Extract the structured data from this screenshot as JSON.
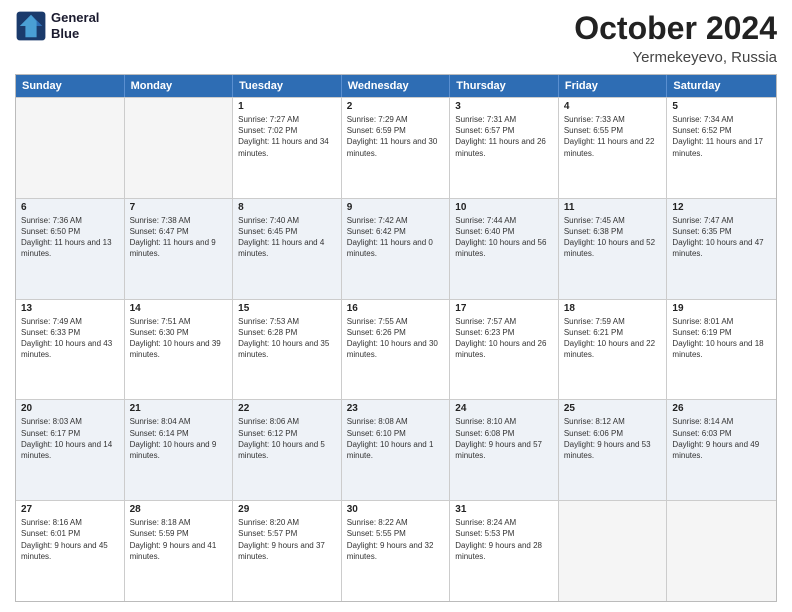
{
  "header": {
    "logo_line1": "General",
    "logo_line2": "Blue",
    "month": "October 2024",
    "location": "Yermekeyevo, Russia"
  },
  "days_of_week": [
    "Sunday",
    "Monday",
    "Tuesday",
    "Wednesday",
    "Thursday",
    "Friday",
    "Saturday"
  ],
  "weeks": [
    [
      {
        "day": "",
        "sunrise": "",
        "sunset": "",
        "daylight": "",
        "empty": true
      },
      {
        "day": "",
        "sunrise": "",
        "sunset": "",
        "daylight": "",
        "empty": true
      },
      {
        "day": "1",
        "sunrise": "Sunrise: 7:27 AM",
        "sunset": "Sunset: 7:02 PM",
        "daylight": "Daylight: 11 hours and 34 minutes."
      },
      {
        "day": "2",
        "sunrise": "Sunrise: 7:29 AM",
        "sunset": "Sunset: 6:59 PM",
        "daylight": "Daylight: 11 hours and 30 minutes."
      },
      {
        "day": "3",
        "sunrise": "Sunrise: 7:31 AM",
        "sunset": "Sunset: 6:57 PM",
        "daylight": "Daylight: 11 hours and 26 minutes."
      },
      {
        "day": "4",
        "sunrise": "Sunrise: 7:33 AM",
        "sunset": "Sunset: 6:55 PM",
        "daylight": "Daylight: 11 hours and 22 minutes."
      },
      {
        "day": "5",
        "sunrise": "Sunrise: 7:34 AM",
        "sunset": "Sunset: 6:52 PM",
        "daylight": "Daylight: 11 hours and 17 minutes."
      }
    ],
    [
      {
        "day": "6",
        "sunrise": "Sunrise: 7:36 AM",
        "sunset": "Sunset: 6:50 PM",
        "daylight": "Daylight: 11 hours and 13 minutes."
      },
      {
        "day": "7",
        "sunrise": "Sunrise: 7:38 AM",
        "sunset": "Sunset: 6:47 PM",
        "daylight": "Daylight: 11 hours and 9 minutes."
      },
      {
        "day": "8",
        "sunrise": "Sunrise: 7:40 AM",
        "sunset": "Sunset: 6:45 PM",
        "daylight": "Daylight: 11 hours and 4 minutes."
      },
      {
        "day": "9",
        "sunrise": "Sunrise: 7:42 AM",
        "sunset": "Sunset: 6:42 PM",
        "daylight": "Daylight: 11 hours and 0 minutes."
      },
      {
        "day": "10",
        "sunrise": "Sunrise: 7:44 AM",
        "sunset": "Sunset: 6:40 PM",
        "daylight": "Daylight: 10 hours and 56 minutes."
      },
      {
        "day": "11",
        "sunrise": "Sunrise: 7:45 AM",
        "sunset": "Sunset: 6:38 PM",
        "daylight": "Daylight: 10 hours and 52 minutes."
      },
      {
        "day": "12",
        "sunrise": "Sunrise: 7:47 AM",
        "sunset": "Sunset: 6:35 PM",
        "daylight": "Daylight: 10 hours and 47 minutes."
      }
    ],
    [
      {
        "day": "13",
        "sunrise": "Sunrise: 7:49 AM",
        "sunset": "Sunset: 6:33 PM",
        "daylight": "Daylight: 10 hours and 43 minutes."
      },
      {
        "day": "14",
        "sunrise": "Sunrise: 7:51 AM",
        "sunset": "Sunset: 6:30 PM",
        "daylight": "Daylight: 10 hours and 39 minutes."
      },
      {
        "day": "15",
        "sunrise": "Sunrise: 7:53 AM",
        "sunset": "Sunset: 6:28 PM",
        "daylight": "Daylight: 10 hours and 35 minutes."
      },
      {
        "day": "16",
        "sunrise": "Sunrise: 7:55 AM",
        "sunset": "Sunset: 6:26 PM",
        "daylight": "Daylight: 10 hours and 30 minutes."
      },
      {
        "day": "17",
        "sunrise": "Sunrise: 7:57 AM",
        "sunset": "Sunset: 6:23 PM",
        "daylight": "Daylight: 10 hours and 26 minutes."
      },
      {
        "day": "18",
        "sunrise": "Sunrise: 7:59 AM",
        "sunset": "Sunset: 6:21 PM",
        "daylight": "Daylight: 10 hours and 22 minutes."
      },
      {
        "day": "19",
        "sunrise": "Sunrise: 8:01 AM",
        "sunset": "Sunset: 6:19 PM",
        "daylight": "Daylight: 10 hours and 18 minutes."
      }
    ],
    [
      {
        "day": "20",
        "sunrise": "Sunrise: 8:03 AM",
        "sunset": "Sunset: 6:17 PM",
        "daylight": "Daylight: 10 hours and 14 minutes."
      },
      {
        "day": "21",
        "sunrise": "Sunrise: 8:04 AM",
        "sunset": "Sunset: 6:14 PM",
        "daylight": "Daylight: 10 hours and 9 minutes."
      },
      {
        "day": "22",
        "sunrise": "Sunrise: 8:06 AM",
        "sunset": "Sunset: 6:12 PM",
        "daylight": "Daylight: 10 hours and 5 minutes."
      },
      {
        "day": "23",
        "sunrise": "Sunrise: 8:08 AM",
        "sunset": "Sunset: 6:10 PM",
        "daylight": "Daylight: 10 hours and 1 minute."
      },
      {
        "day": "24",
        "sunrise": "Sunrise: 8:10 AM",
        "sunset": "Sunset: 6:08 PM",
        "daylight": "Daylight: 9 hours and 57 minutes."
      },
      {
        "day": "25",
        "sunrise": "Sunrise: 8:12 AM",
        "sunset": "Sunset: 6:06 PM",
        "daylight": "Daylight: 9 hours and 53 minutes."
      },
      {
        "day": "26",
        "sunrise": "Sunrise: 8:14 AM",
        "sunset": "Sunset: 6:03 PM",
        "daylight": "Daylight: 9 hours and 49 minutes."
      }
    ],
    [
      {
        "day": "27",
        "sunrise": "Sunrise: 8:16 AM",
        "sunset": "Sunset: 6:01 PM",
        "daylight": "Daylight: 9 hours and 45 minutes."
      },
      {
        "day": "28",
        "sunrise": "Sunrise: 8:18 AM",
        "sunset": "Sunset: 5:59 PM",
        "daylight": "Daylight: 9 hours and 41 minutes."
      },
      {
        "day": "29",
        "sunrise": "Sunrise: 8:20 AM",
        "sunset": "Sunset: 5:57 PM",
        "daylight": "Daylight: 9 hours and 37 minutes."
      },
      {
        "day": "30",
        "sunrise": "Sunrise: 8:22 AM",
        "sunset": "Sunset: 5:55 PM",
        "daylight": "Daylight: 9 hours and 32 minutes."
      },
      {
        "day": "31",
        "sunrise": "Sunrise: 8:24 AM",
        "sunset": "Sunset: 5:53 PM",
        "daylight": "Daylight: 9 hours and 28 minutes."
      },
      {
        "day": "",
        "sunrise": "",
        "sunset": "",
        "daylight": "",
        "empty": true
      },
      {
        "day": "",
        "sunrise": "",
        "sunset": "",
        "daylight": "",
        "empty": true
      }
    ]
  ]
}
